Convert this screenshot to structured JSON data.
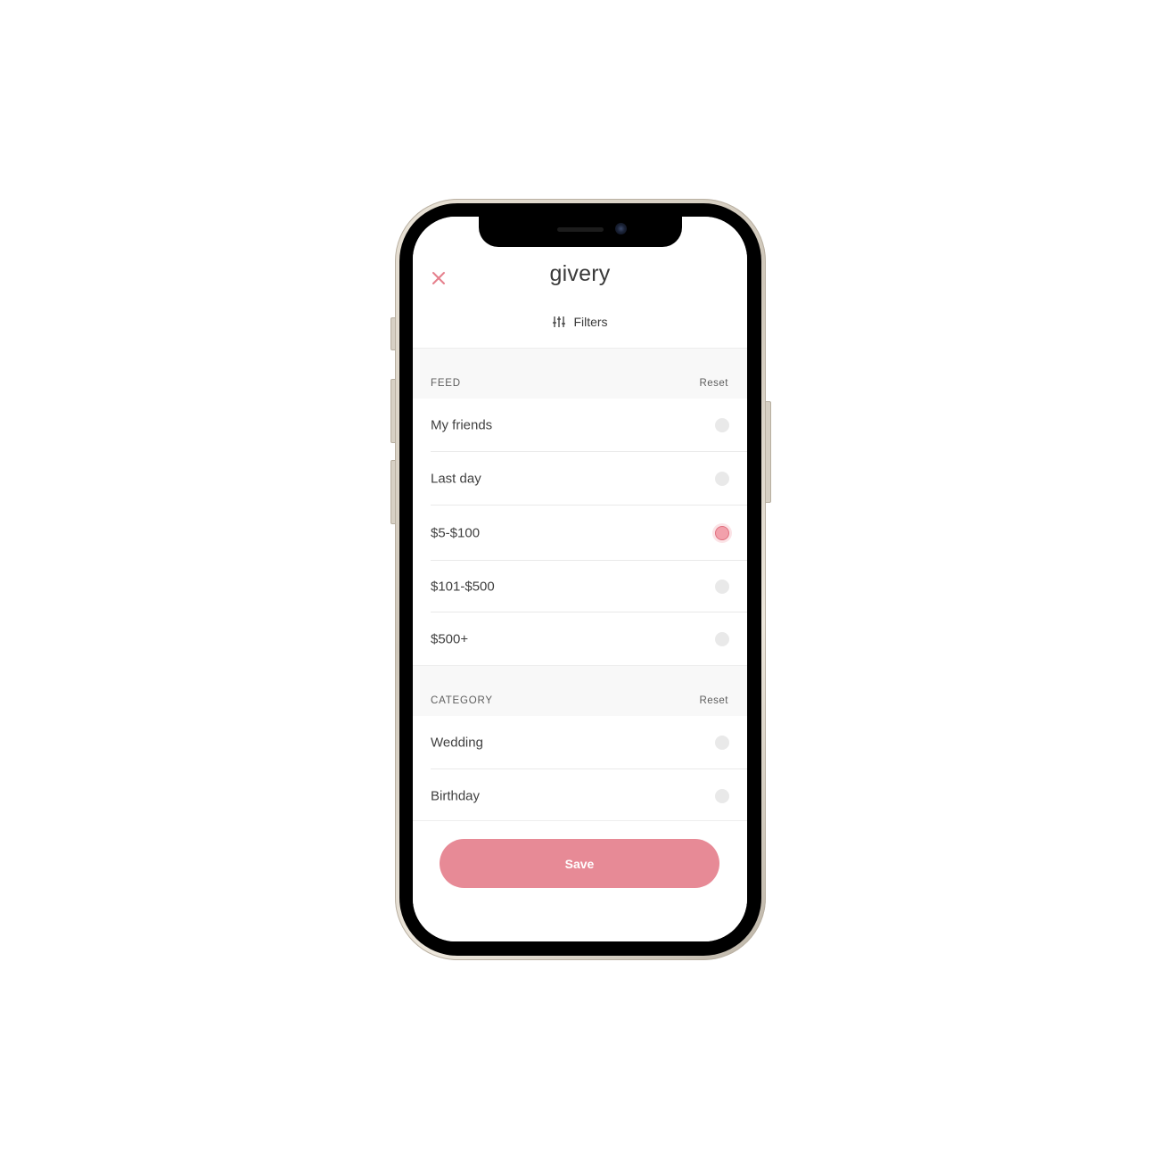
{
  "header": {
    "logo": "givery",
    "filters_label": "Filters"
  },
  "feed": {
    "title": "FEED",
    "reset_label": "Reset",
    "items": [
      {
        "label": "My friends",
        "selected": false
      },
      {
        "label": "Last day",
        "selected": false
      },
      {
        "label": "$5-$100",
        "selected": true
      },
      {
        "label": "$101-$500",
        "selected": false
      },
      {
        "label": "$500+",
        "selected": false
      }
    ]
  },
  "category": {
    "title": "CATEGORY",
    "reset_label": "Reset",
    "items": [
      {
        "label": "Wedding",
        "selected": false
      },
      {
        "label": "Birthday",
        "selected": false
      }
    ]
  },
  "footer": {
    "save_label": "Save"
  },
  "colors": {
    "accent": "#e78a96",
    "close_icon": "#e57f8c",
    "selected_radio": "#f2a0ab",
    "unselected_radio": "#e9e9e9",
    "section_bg": "#f8f8f8"
  },
  "icons": {
    "close": "close-icon",
    "filters": "sliders-icon"
  }
}
